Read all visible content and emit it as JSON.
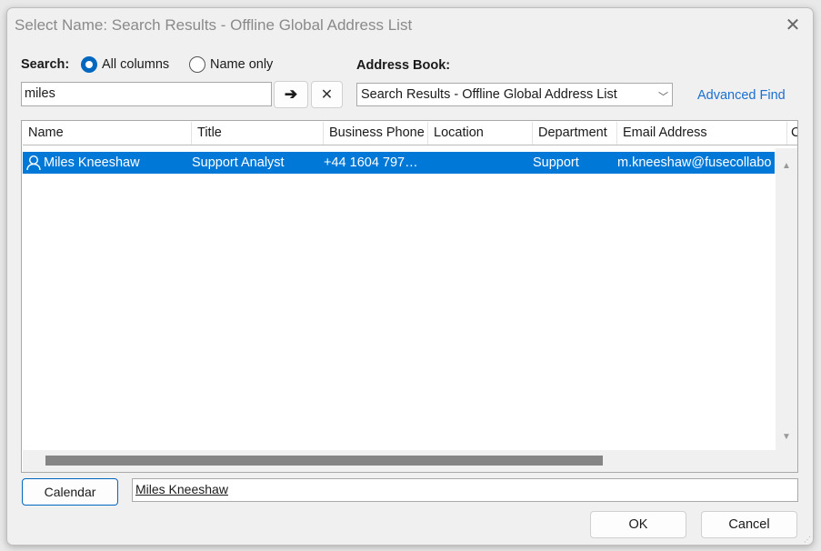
{
  "window": {
    "title": "Select Name: Search Results - Offline Global Address List",
    "close_icon": "close-icon"
  },
  "search": {
    "label": "Search:",
    "options": [
      {
        "label": "All columns",
        "selected": true
      },
      {
        "label": "Name only",
        "selected": false
      }
    ],
    "value": "miles",
    "go_icon": "arrow-right-icon",
    "clear_icon": "close-icon"
  },
  "address_book": {
    "label": "Address Book:",
    "selected": "Search Results - Offline Global Address List",
    "advanced_find": "Advanced Find"
  },
  "table": {
    "columns": [
      "Name",
      "Title",
      "Business Phone",
      "Location",
      "Department",
      "Email Address",
      "C"
    ],
    "rows": [
      {
        "name": "Miles Kneeshaw",
        "title": "Support Analyst",
        "phone": "+44 1604 797…",
        "location": "",
        "department": "Support",
        "email": "m.kneeshaw@fusecollabo",
        "selected": true
      }
    ]
  },
  "footer": {
    "calendar": "Calendar",
    "recipient": "Miles Kneeshaw",
    "ok": "OK",
    "cancel": "Cancel"
  },
  "colors": {
    "accent": "#0078d7",
    "link": "#1a6fd0"
  }
}
